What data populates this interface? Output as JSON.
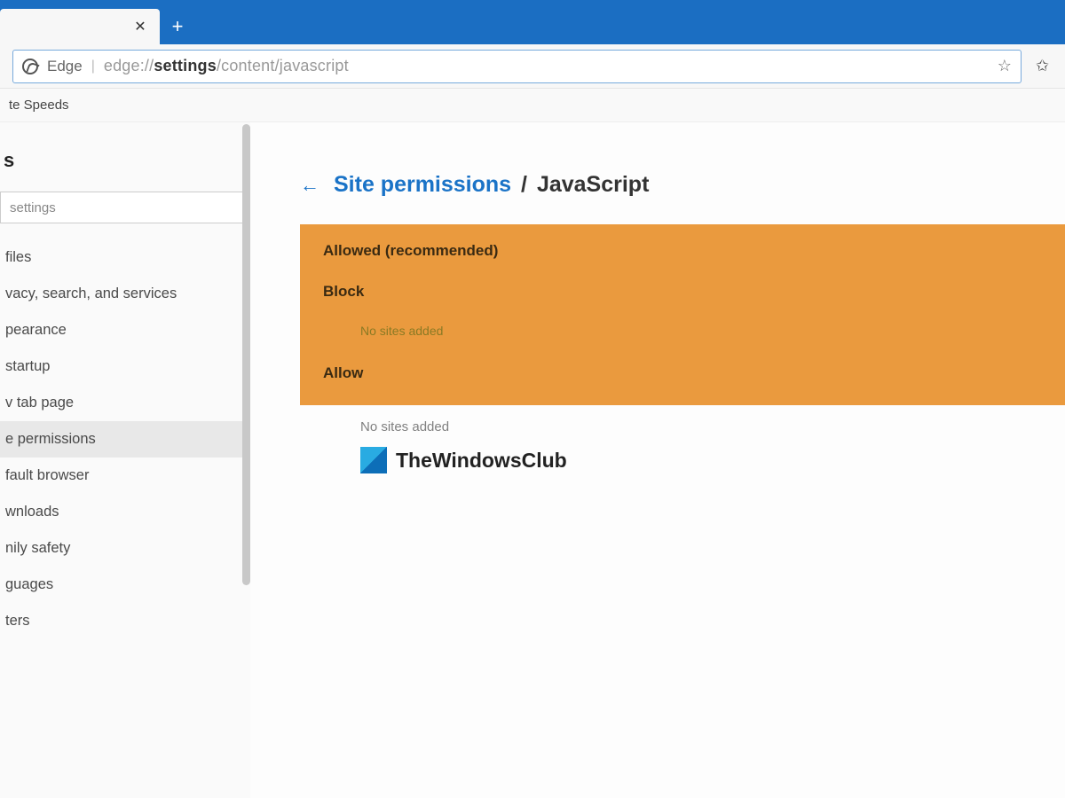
{
  "tabbar": {
    "close_glyph": "✕",
    "newtab_glyph": "+"
  },
  "addressbar": {
    "app_label": "Edge",
    "url_prefix": "edge://",
    "url_bold": "settings",
    "url_suffix": "/content/javascript",
    "star_glyph": "☆",
    "fav_glyph": "✩"
  },
  "bookmarks": {
    "item0": "te Speeds"
  },
  "sidebar": {
    "heading": "s",
    "search_placeholder": "settings",
    "items": [
      "files",
      "vacy, search, and services",
      "pearance",
      "startup",
      "v tab page",
      "e permissions",
      "fault browser",
      "wnloads",
      "nily safety",
      "guages",
      "ters"
    ],
    "active_index": 5
  },
  "main": {
    "back_glyph": "←",
    "breadcrumb_link": "Site permissions",
    "breadcrumb_sep": "/",
    "breadcrumb_current": "JavaScript",
    "allowed_label": "Allowed (recommended)",
    "block_label": "Block",
    "block_empty": "No sites added",
    "allow_label": "Allow",
    "allow_empty": "No sites added",
    "brand": "TheWindowsClub"
  }
}
